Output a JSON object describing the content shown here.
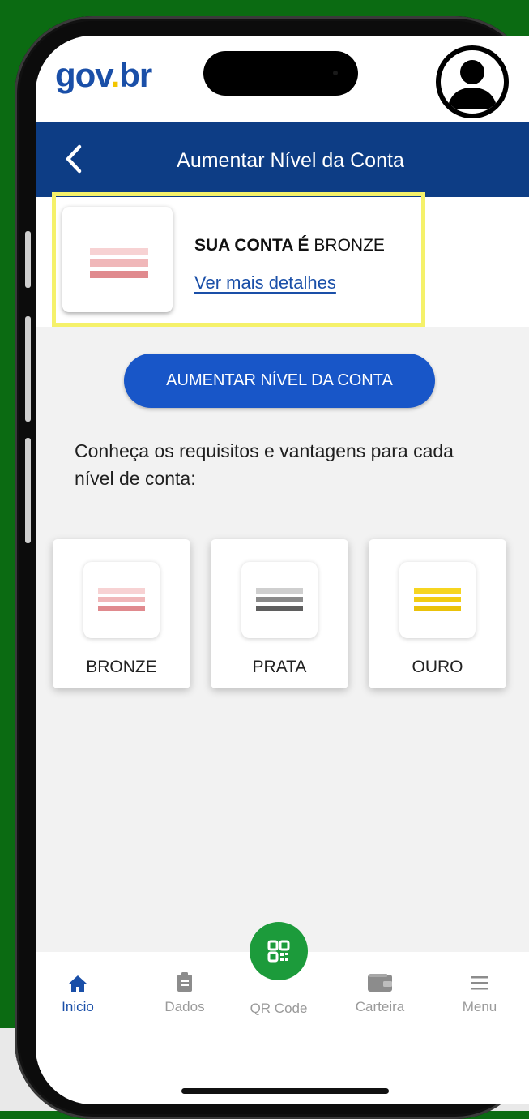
{
  "logo": {
    "part1": "gov",
    "part2": ".",
    "part3": "br"
  },
  "header": {
    "title": "Aumentar Nível da Conta"
  },
  "account": {
    "prefix": "SUA CONTA É",
    "level": "BRONZE",
    "details_link": "Ver mais detalhes"
  },
  "actions": {
    "upgrade_button": "AUMENTAR NÍVEL DA CONTA"
  },
  "info_text": "Conheça os requisitos e vantagens para cada nível de conta:",
  "levels": [
    {
      "label": "BRONZE",
      "color": "#e79a9d"
    },
    {
      "label": "PRATA",
      "color": "#6e6e6e"
    },
    {
      "label": "OURO",
      "color": "#f2cc12"
    }
  ],
  "tabs": [
    {
      "label": "Inicio",
      "icon": "home-icon",
      "active": true
    },
    {
      "label": "Dados",
      "icon": "clipboard-icon"
    },
    {
      "label": "QR Code",
      "icon": "qr-code-icon"
    },
    {
      "label": "Carteira",
      "icon": "wallet-icon"
    },
    {
      "label": "Menu",
      "icon": "menu-icon"
    }
  ],
  "colors": {
    "brand_blue": "#0d3d85",
    "button_blue": "#1856c8",
    "qr_green": "#1c9b3b",
    "highlight": "#f5f16a",
    "background_green": "#0b6b12"
  }
}
